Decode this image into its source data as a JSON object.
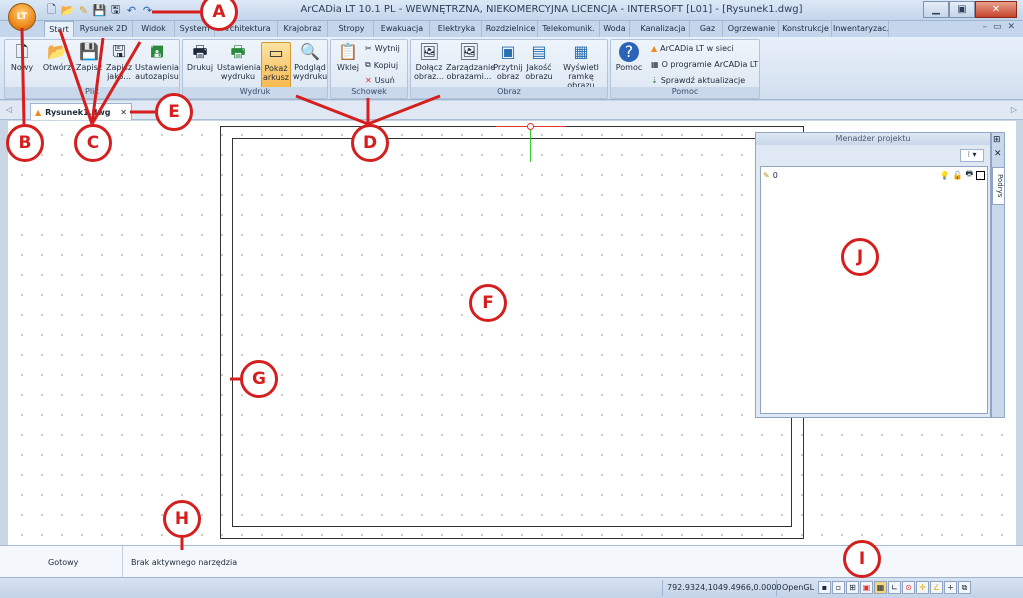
{
  "app": {
    "title": "ArCADia LT 10.1 PL - WEWNĘTRZNA, NIEKOMERCYJNA LICENCJA - INTERSOFT [L01] - [Rysunek1.dwg]",
    "app_button_label": "LT"
  },
  "ribbon": {
    "tabs": [
      "Start",
      "Rysunek 2D",
      "Widok",
      "System",
      "Architektura",
      "Krajobraz",
      "Stropy",
      "Ewakuacja",
      "Elektryka",
      "Rozdzielnice",
      "Telekomunik.",
      "Woda",
      "Kanalizacja",
      "Gaz",
      "Ogrzewanie",
      "Konstrukcje",
      "Inwentaryzac."
    ],
    "groups": {
      "plik": {
        "label": "Plik",
        "buttons": [
          "Nowy",
          "Otwórz",
          "Zapisz",
          "Zapisz jako...",
          "Ustawienia autozapisu"
        ]
      },
      "wydruk": {
        "label": "Wydruk",
        "buttons": [
          "Drukuj",
          "Ustawienia wydruku",
          "Pokaż arkusz",
          "Podgląd wydruku"
        ]
      },
      "schowek": {
        "label": "Schowek",
        "paste": "Wklej",
        "cut": "Wytnij",
        "copy": "Kopiuj",
        "delete": "Usuń"
      },
      "obraz": {
        "label": "Obraz",
        "buttons": [
          "Dołącz obraz...",
          "Zarządzanie obrazami...",
          "Przytnij obraz",
          "Jakość obrazu",
          "Wyświetl ramkę obrazu"
        ]
      },
      "pomoc": {
        "label": "Pomoc",
        "help": "Pomoc",
        "online": "ArCADia LT w sieci",
        "about": "O programie ArCADia LT",
        "update": "Sprawdź aktualizacje"
      }
    }
  },
  "document_tab": {
    "label": "Rysunek1.dwg"
  },
  "project_manager": {
    "title": "Menadżer projektu",
    "layer_name": "0",
    "side_tab": "Podrys"
  },
  "command_bar": {
    "status": "Gotowy",
    "tool": "Brak aktywnego narzędzia"
  },
  "statusbar": {
    "coordinates": "792.9324,1049.4966,0.0000",
    "renderer": "OpenGL"
  },
  "callouts": [
    "A",
    "B",
    "C",
    "D",
    "E",
    "F",
    "G",
    "H",
    "I",
    "J"
  ],
  "colors": {
    "callout_red": "#d51f1f",
    "accent_orange": "#f08a1c",
    "ribbon_blue": "#c4d6ec"
  }
}
